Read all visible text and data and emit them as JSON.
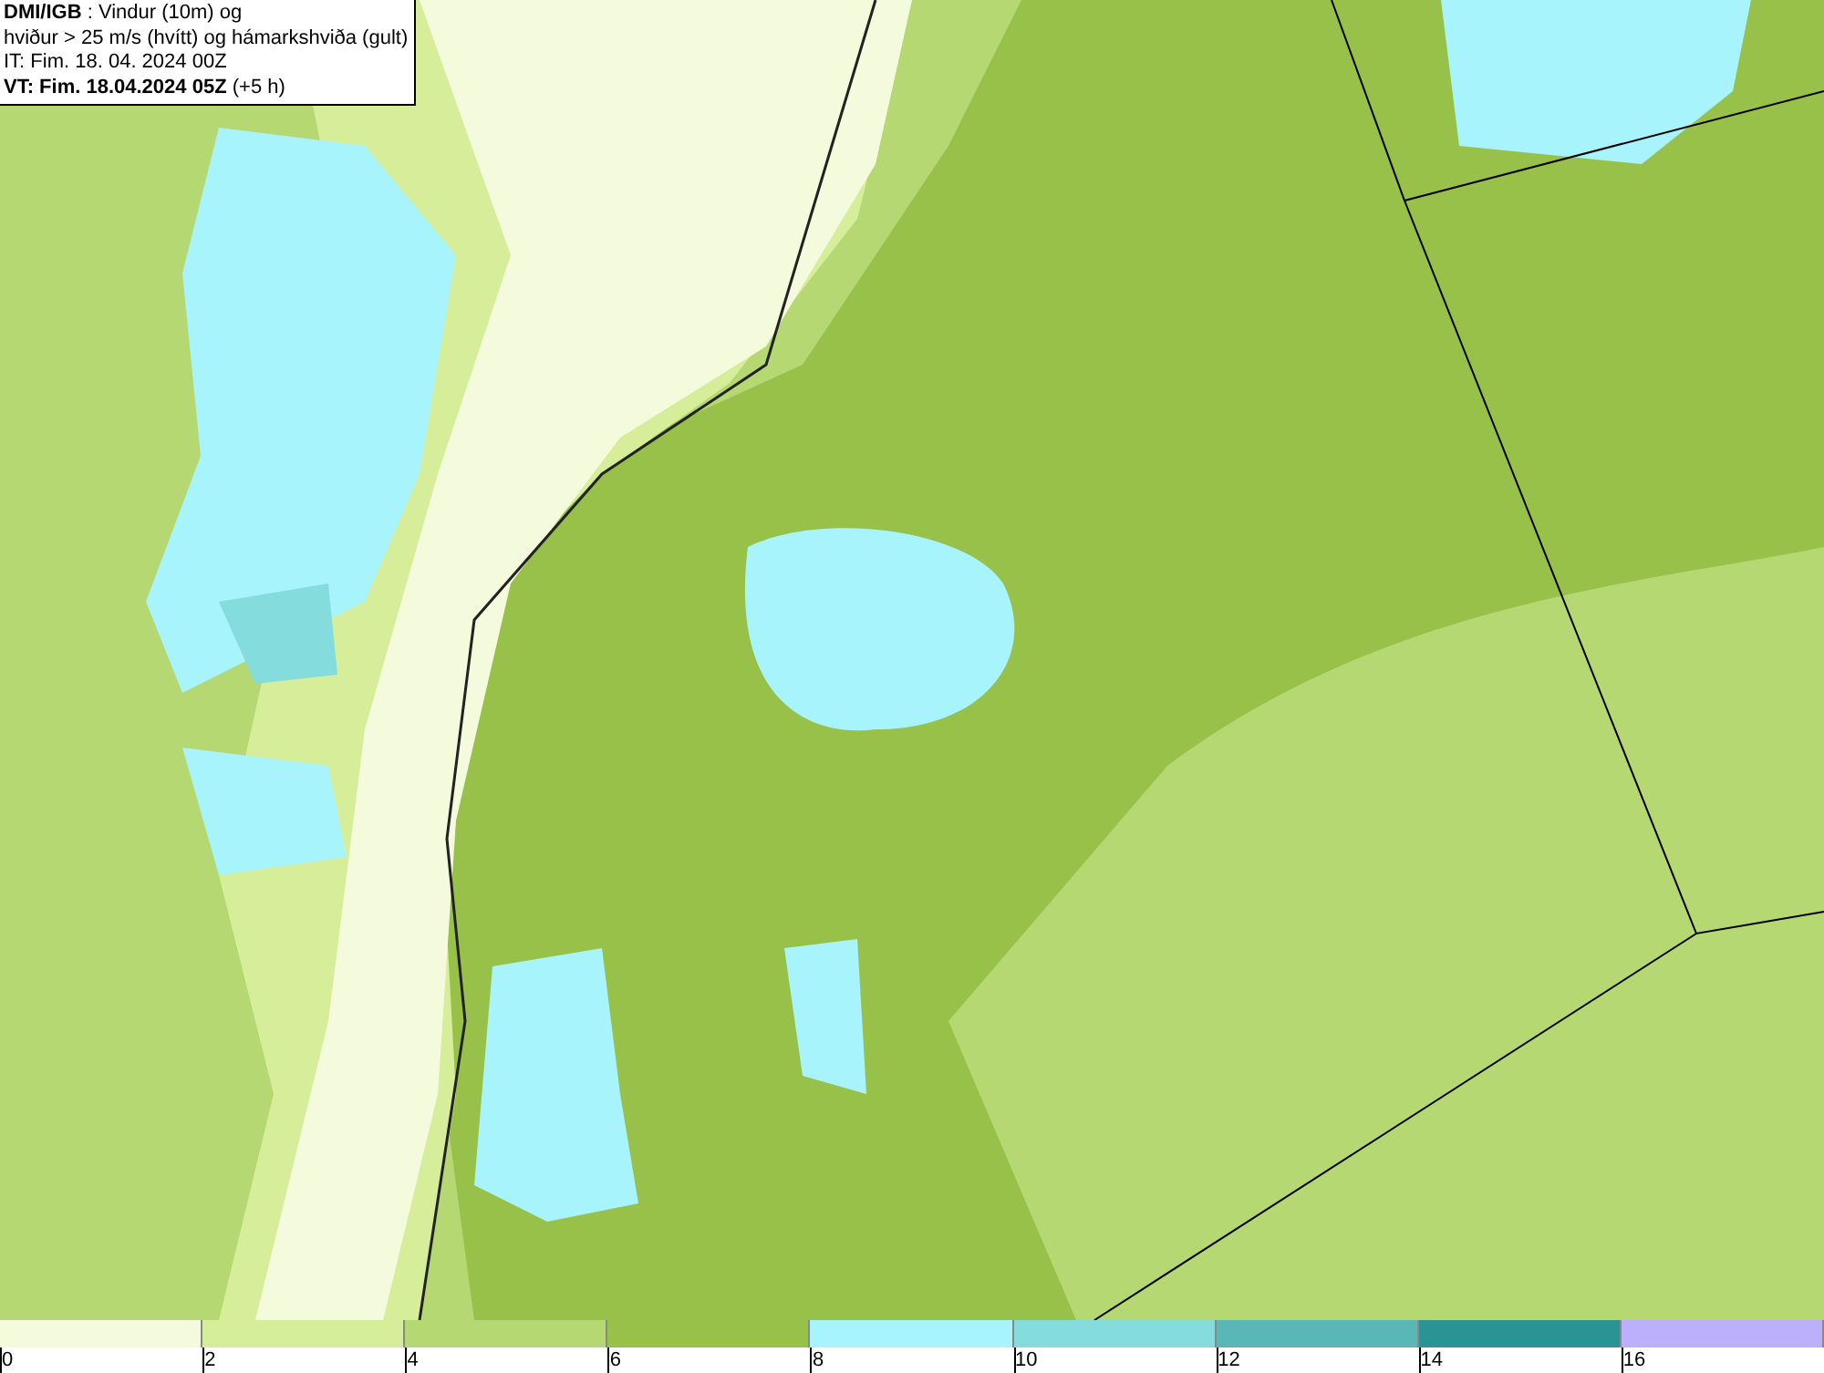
{
  "header": {
    "lines": [
      "**DMI/IGB** : Vindur (10m) og",
      "hviður > 25 m/s (hvítt) og hámarkshviða (gult)",
      "IT: Fim. 18. 04. 2024 00Z",
      "**VT: Fim. 18.04.2024 05Z** (+5 h)"
    ]
  },
  "legend": {
    "bins": [
      {
        "color": "#f4fadc"
      },
      {
        "color": "#d6ee9a"
      },
      {
        "color": "#b5d873"
      },
      {
        "color": "#98c14a"
      },
      {
        "color": "#a8f4fc"
      },
      {
        "color": "#84dcdc"
      },
      {
        "color": "#5ab7b7"
      },
      {
        "color": "#2a9494"
      },
      {
        "color": "#bcb0fc"
      }
    ],
    "ticks": [
      "0",
      "2",
      "4",
      "6",
      "8",
      "10",
      "12",
      "14",
      "16"
    ]
  }
}
